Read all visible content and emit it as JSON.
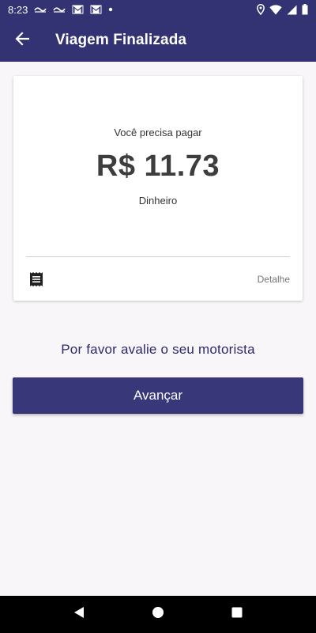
{
  "status_bar": {
    "time": "8:23",
    "icons": [
      "notification-icon",
      "notification-icon",
      "gmail-icon",
      "gmail-icon",
      "dot-icon",
      "location-icon",
      "wifi-icon",
      "signal-icon",
      "battery-icon"
    ]
  },
  "app_bar": {
    "title": "Viagem Finalizada",
    "back_icon": "arrow-back-icon"
  },
  "payment_card": {
    "label": "Você precisa pagar",
    "amount": "R$ 11.73",
    "method": "Dinheiro",
    "detail_label": "Detalhe",
    "receipt_icon": "receipt-icon"
  },
  "rating": {
    "prompt": "Por favor avalie o seu motorista"
  },
  "actions": {
    "next_label": "Avançar"
  },
  "colors": {
    "primary": "#333273",
    "button": "#373779",
    "rate_text": "#2b2a6e",
    "background": "#f8f6f8"
  }
}
